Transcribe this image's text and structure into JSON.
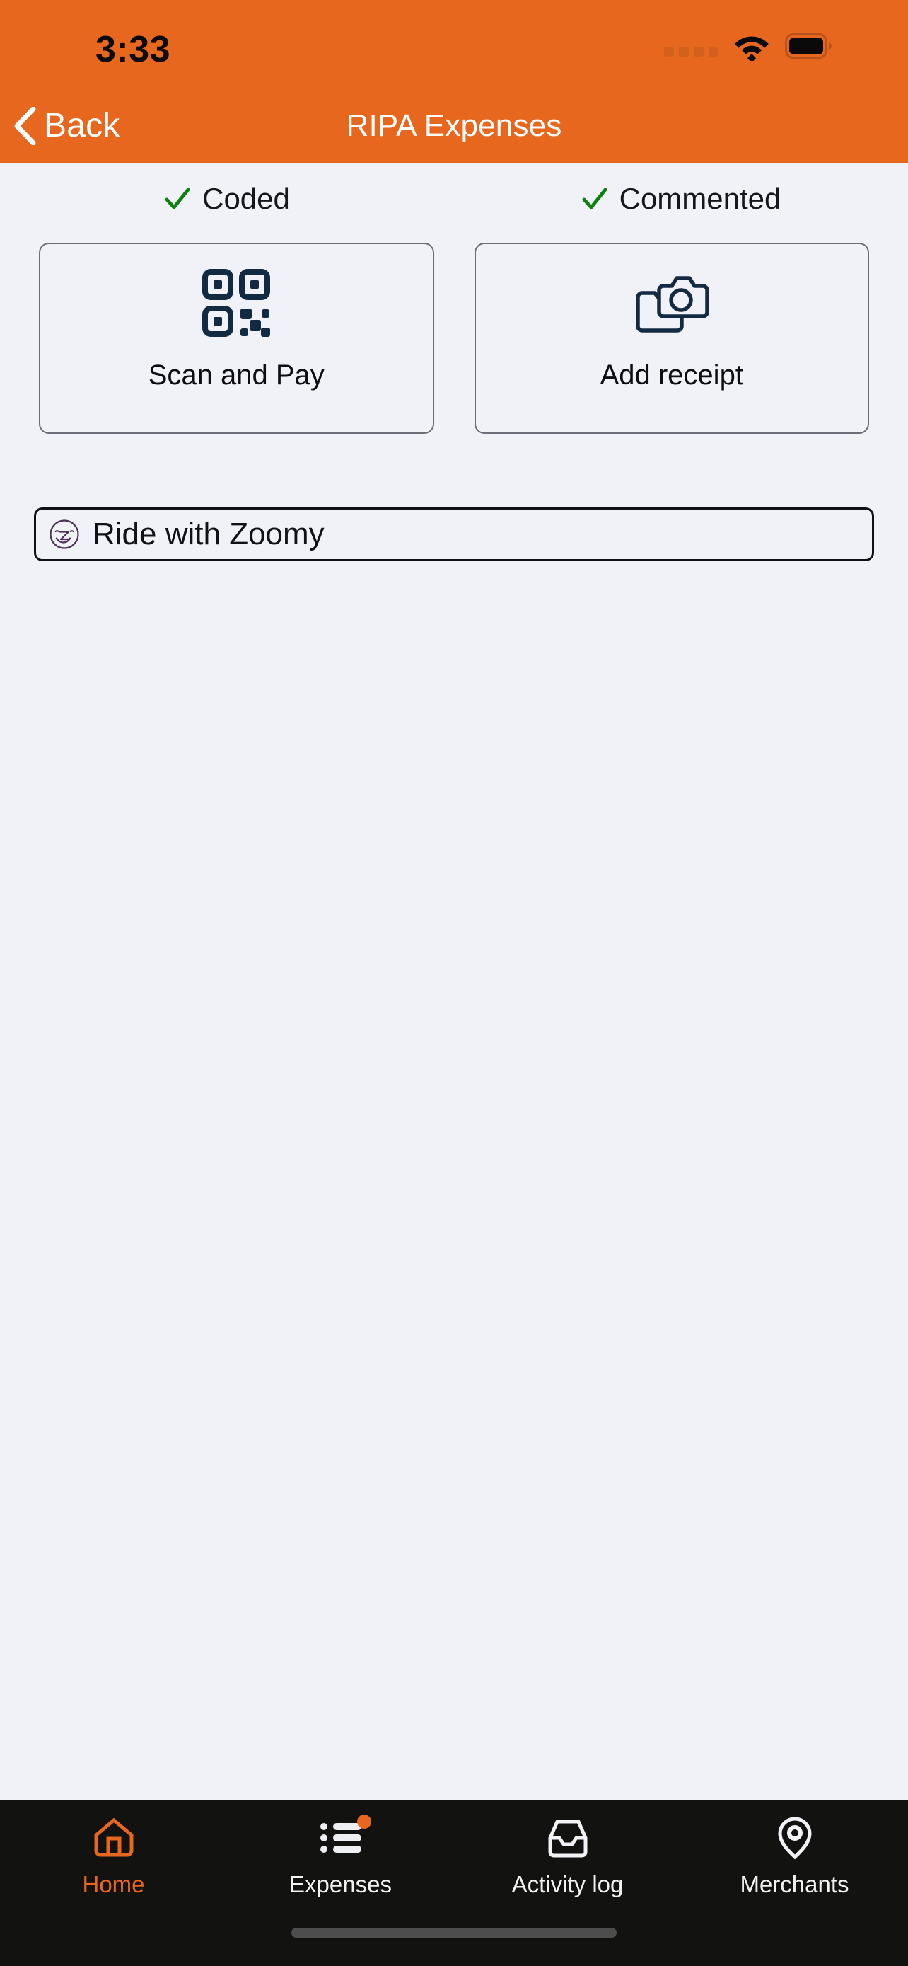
{
  "status_bar": {
    "time": "3:33",
    "signal_icon": "signal-dots-icon",
    "wifi_icon": "wifi-icon",
    "battery_icon": "battery-full-icon"
  },
  "nav": {
    "back_icon": "chevron-left-icon",
    "back_label": "Back",
    "title": "RIPA Expenses"
  },
  "status_row": [
    {
      "icon": "check-icon",
      "label": "Coded"
    },
    {
      "icon": "check-icon",
      "label": "Commented"
    }
  ],
  "cards": [
    {
      "icon": "qr-code-icon",
      "label": "Scan and Pay"
    },
    {
      "icon": "camera-receipt-icon",
      "label": "Add receipt"
    }
  ],
  "merchant_row": {
    "icon": "zoomy-logo-icon",
    "label": "Ride with Zoomy"
  },
  "tab_bar": {
    "items": [
      {
        "icon": "home-icon",
        "label": "Home",
        "active": true,
        "badge": false
      },
      {
        "icon": "list-icon",
        "label": "Expenses",
        "active": false,
        "badge": true
      },
      {
        "icon": "inbox-icon",
        "label": "Activity log",
        "active": false,
        "badge": false
      },
      {
        "icon": "map-pin-icon",
        "label": "Merchants",
        "active": false,
        "badge": false
      }
    ]
  },
  "colors": {
    "brand_orange": "#E8671F",
    "page_background": "#F1F2F7",
    "tab_bar_background": "#121210",
    "icon_navy": "#132B42",
    "check_green": "#108010",
    "zoomy_purple": "#4A3355",
    "card_border": "#6E6D77",
    "row_border": "#111216"
  }
}
